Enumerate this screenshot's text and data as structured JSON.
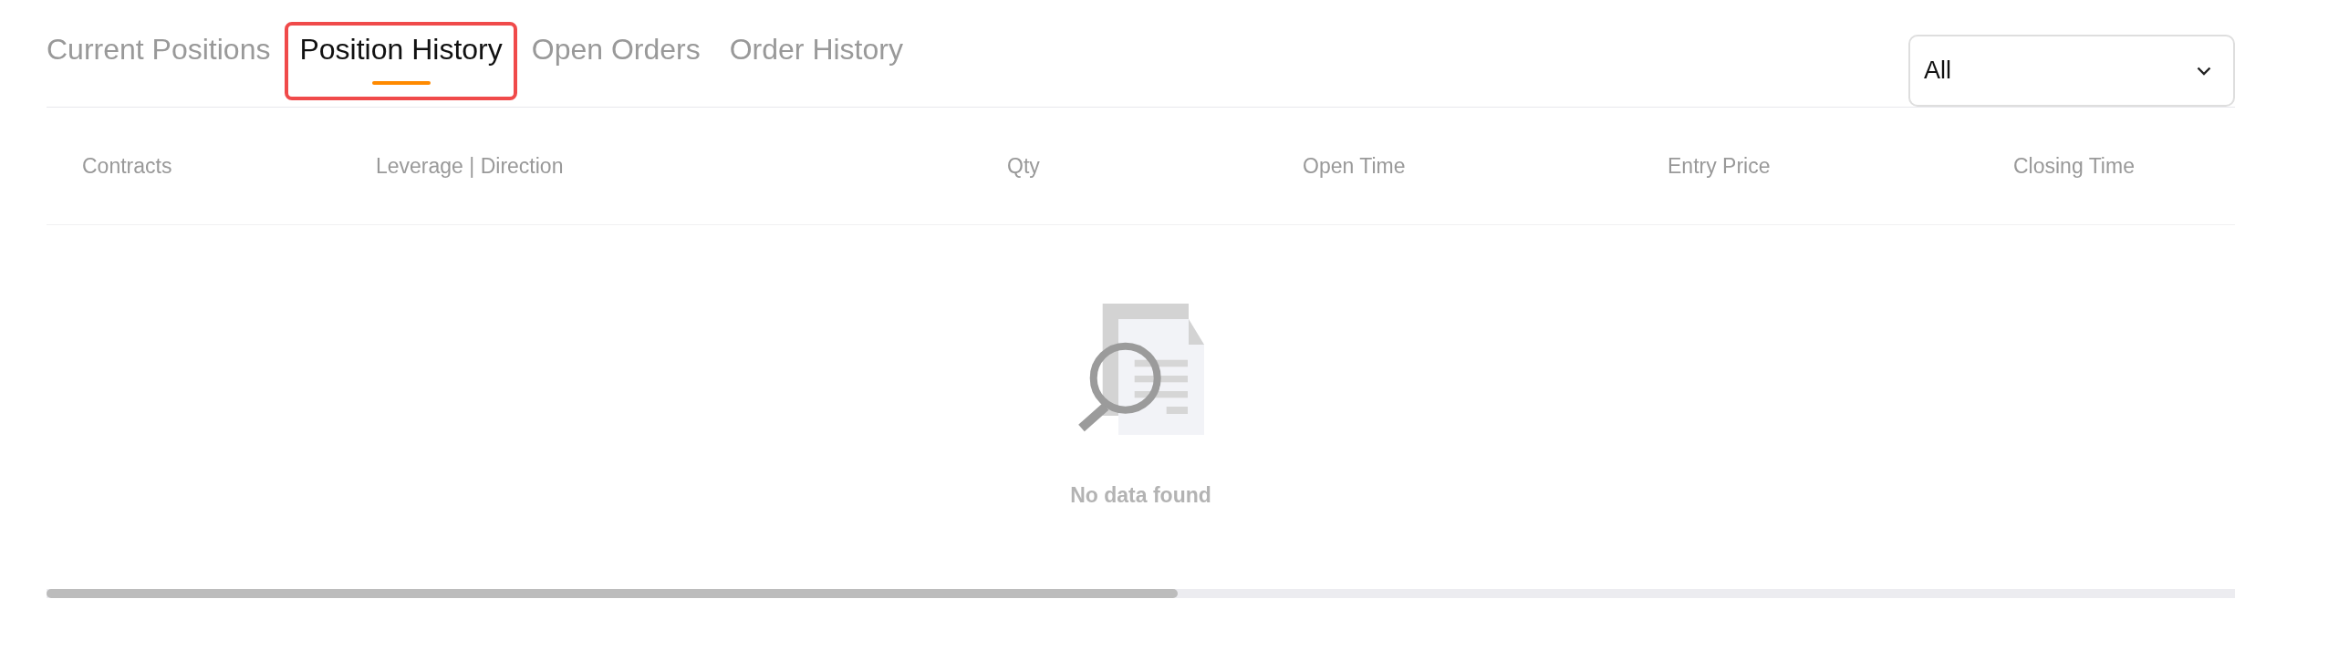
{
  "tabs": [
    {
      "label": "Current Positions",
      "selected": false,
      "highlighted": false
    },
    {
      "label": "Position History",
      "selected": true,
      "highlighted": true
    },
    {
      "label": "Open Orders",
      "selected": false,
      "highlighted": false
    },
    {
      "label": "Order History",
      "selected": false,
      "highlighted": false
    }
  ],
  "filter": {
    "value": "All"
  },
  "table": {
    "columns": [
      "Contracts",
      "Leverage | Direction",
      "Qty",
      "Open Time",
      "Entry Price",
      "Closing Time"
    ],
    "empty_state": {
      "message": "No data found"
    }
  }
}
